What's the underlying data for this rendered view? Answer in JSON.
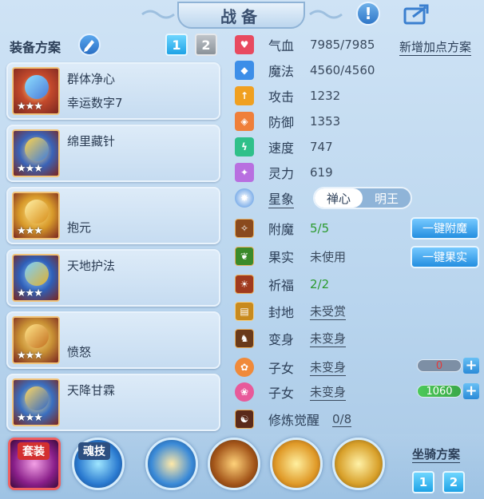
{
  "header": {
    "title": "战备"
  },
  "equip_panel": {
    "label": "装备方案",
    "plan_buttons": [
      "1",
      "2"
    ],
    "items": [
      {
        "line1": "群体净心",
        "line2": "幸运数字7",
        "stars": "★★★"
      },
      {
        "line1": "绵里藏针",
        "line2": "",
        "stars": "★★★"
      },
      {
        "line1": "",
        "line2": "抱元",
        "stars": "★★★"
      },
      {
        "line1": "天地护法",
        "line2": "",
        "stars": "★★★"
      },
      {
        "line1": "",
        "line2": "愤怒",
        "stars": "★★★"
      },
      {
        "line1": "天降甘霖",
        "line2": "",
        "stars": "★★★"
      }
    ]
  },
  "stats": {
    "add_points": "新增加点方案",
    "rows": [
      {
        "name": "气血",
        "value": "7985/7985",
        "color": "#e84a5f"
      },
      {
        "name": "魔法",
        "value": "4560/4560",
        "color": "#3c8ee8"
      },
      {
        "name": "攻击",
        "value": "1232",
        "color": "#f0a020"
      },
      {
        "name": "防御",
        "value": "1353",
        "color": "#ef7f3a"
      },
      {
        "name": "速度",
        "value": "747",
        "color": "#2fc08a"
      },
      {
        "name": "灵力",
        "value": "619",
        "color": "#b86fe0"
      }
    ],
    "constellation": {
      "name": "星象",
      "options": [
        "禅心",
        "明王"
      ],
      "selected": "禅心"
    },
    "extras": [
      {
        "name": "附魔",
        "value": "5/5",
        "green": true,
        "button": "一键附魔"
      },
      {
        "name": "果实",
        "value": "未使用",
        "green": false,
        "button": "一键果实"
      },
      {
        "name": "祈福",
        "value": "2/2",
        "green": true
      },
      {
        "name": "封地",
        "value": "未受赏",
        "underline": true
      },
      {
        "name": "变身",
        "value": "未变身",
        "underline": true
      },
      {
        "name": "子女",
        "value": "未变身",
        "underline": true,
        "bar": "0",
        "bar_style": "red"
      },
      {
        "name": "子女",
        "value": "未变身",
        "underline": true,
        "bar": "1060",
        "bar_style": "green"
      },
      {
        "name": "修炼觉醒",
        "value": "0/8",
        "underline": true
      }
    ]
  },
  "bottom": {
    "tag_suit": "套装",
    "tag_soul": "魂技",
    "mount_label": "坐骑方案",
    "mount_buttons": [
      "1",
      "2"
    ],
    "plus": "+"
  }
}
